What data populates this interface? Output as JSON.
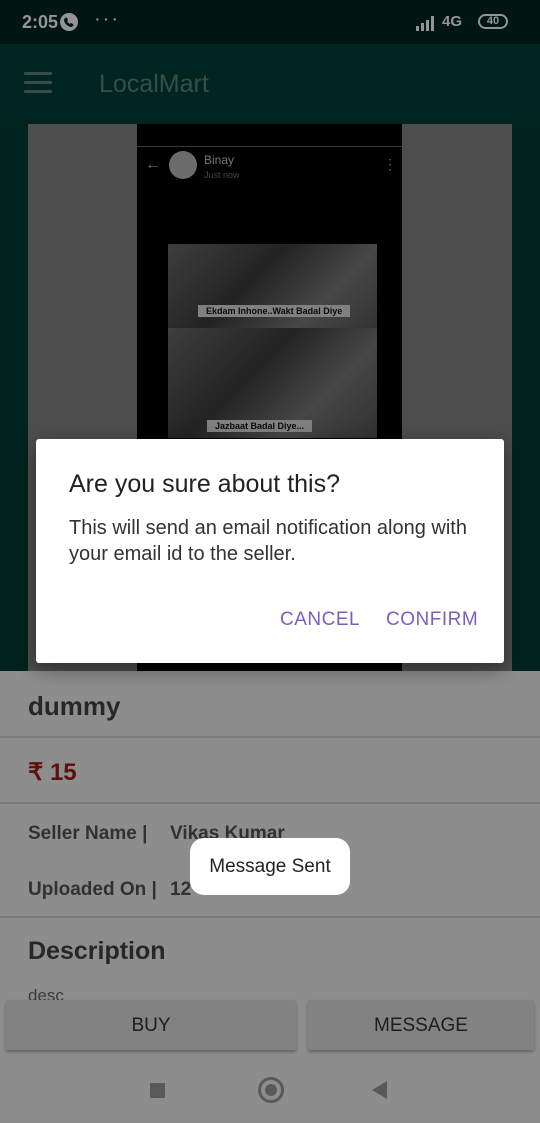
{
  "status_bar": {
    "time": "2:05",
    "dots": "···",
    "network": "4G",
    "battery": "40"
  },
  "app_bar": {
    "title": "LocalMart"
  },
  "hero": {
    "chat_name": "Binay",
    "chat_status": "Just now",
    "caption_1": "Ekdam Inhone..Wakt Badal Diye",
    "caption_2": "Jazbaat Badal Diye..."
  },
  "product": {
    "title": "dummy",
    "price": "₹ 15",
    "seller_label": "Seller Name |",
    "seller_value": "Vikas Kumar",
    "uploaded_label": "Uploaded On |",
    "uploaded_value": "12",
    "description_heading": "Description",
    "description_value": "desc"
  },
  "actions": {
    "buy": "BUY",
    "message": "MESSAGE"
  },
  "dialog": {
    "title": "Are you sure about this?",
    "body": "This will send an email notification along with your email id to the seller.",
    "cancel": "CANCEL",
    "confirm": "CONFIRM"
  },
  "toast": {
    "text": "Message Sent"
  },
  "colors": {
    "accent": "#7a5fbf",
    "primary_dark": "#013f36",
    "price": "#a61b1b"
  }
}
